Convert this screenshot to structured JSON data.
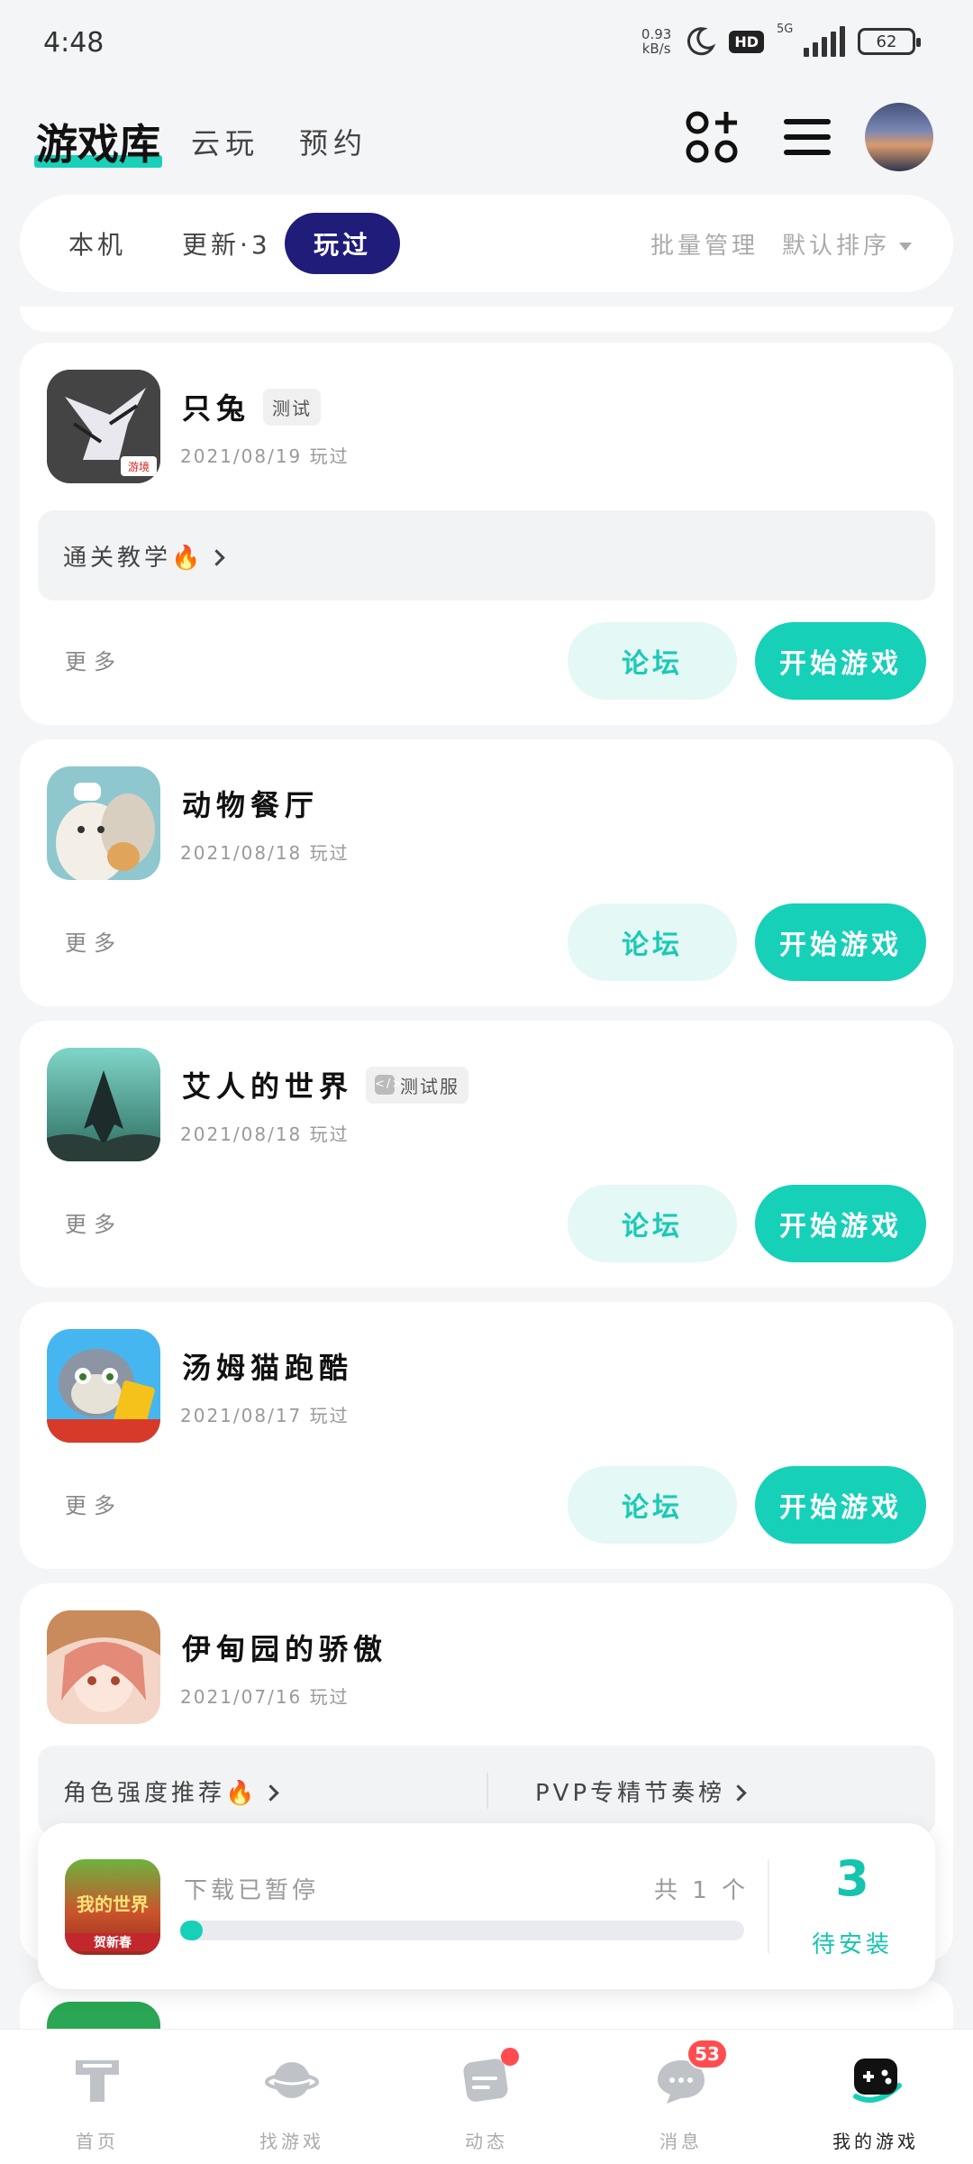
{
  "status_bar": {
    "time": "4:48",
    "net_speed": "0.93",
    "net_unit": "kB/s",
    "hd": "HD",
    "network": "5G",
    "battery": "62"
  },
  "header": {
    "tabs": [
      "游戏库",
      "云玩",
      "预约"
    ]
  },
  "filter": {
    "tabs": [
      "本机",
      "更新·3",
      "玩过"
    ],
    "active": "玩过",
    "batch": "批量管理",
    "sort": "默认排序"
  },
  "games": [
    {
      "title": "只兔",
      "tag": "测试",
      "date": "2021/08/19 玩过",
      "guide": "通关教学",
      "more": "更多",
      "forum": "论坛",
      "play": "开始游戏"
    },
    {
      "title": "动物餐厅",
      "date": "2021/08/18 玩过",
      "more": "更多",
      "forum": "论坛",
      "play": "开始游戏"
    },
    {
      "title": "艾人的世界",
      "tag": "测试服",
      "date": "2021/08/18 玩过",
      "more": "更多",
      "forum": "论坛",
      "play": "开始游戏"
    },
    {
      "title": "汤姆猫跑酷",
      "date": "2021/08/17 玩过",
      "more": "更多",
      "forum": "论坛",
      "play": "开始游戏"
    },
    {
      "title": "伊甸园的骄傲",
      "date": "2021/07/16 玩过",
      "links": [
        "角色强度推荐",
        "PVP专精节奏榜"
      ]
    }
  ],
  "download": {
    "status": "下载已暂停",
    "count": "共 1 个",
    "progress": 0.04,
    "pending_num": "3",
    "pending_label": "待安装",
    "icon_text": "我的世界",
    "icon_sub": "贺新春"
  },
  "bottom_nav": [
    {
      "label": "首页",
      "icon": "home-icon"
    },
    {
      "label": "找游戏",
      "icon": "planet-icon"
    },
    {
      "label": "动态",
      "icon": "feed-icon"
    },
    {
      "label": "消息",
      "icon": "message-icon",
      "badge": "53"
    },
    {
      "label": "我的游戏",
      "icon": "gamepad-icon",
      "active": true
    }
  ],
  "colors": {
    "accent": "#16d0b8",
    "active_tab": "#1f1c7a",
    "badge": "#ff4d4f"
  }
}
